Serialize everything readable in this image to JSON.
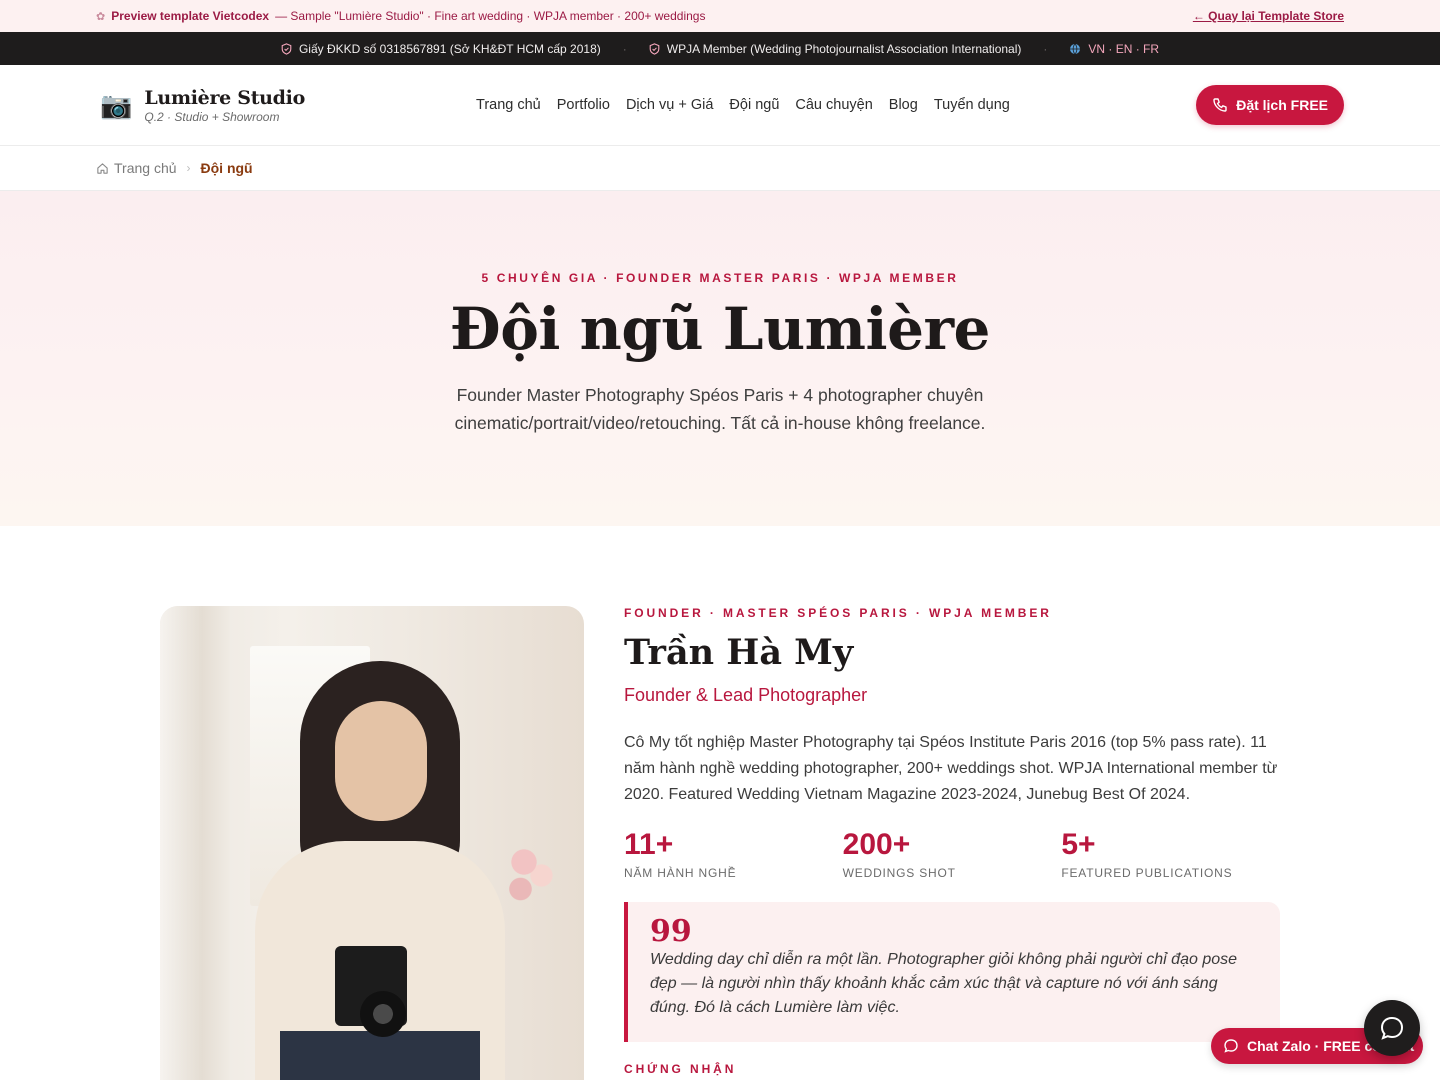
{
  "preview": {
    "brand": "Preview template Vietcodex",
    "desc": "— Sample \"Lumière Studio\" · Fine art wedding · WPJA member · 200+ weddings",
    "back_link": "← Quay lại Template Store"
  },
  "infobar": {
    "license": "Giấy ĐKKD số 0318567891 (Sở KH&ĐT HCM cấp 2018)",
    "member": "WPJA Member (Wedding Photojournalist Association International)",
    "langs": "VN · EN · FR",
    "sep": "·"
  },
  "header": {
    "logo_icon": "📷",
    "logo_title": "Lumière Studio",
    "logo_sub": "Q.2 · Studio + Showroom",
    "nav": [
      "Trang chủ",
      "Portfolio",
      "Dịch vụ + Giá",
      "Đội ngũ",
      "Câu chuyện",
      "Blog",
      "Tuyển dụng"
    ],
    "cta": "Đặt lịch FREE"
  },
  "breadcrumb": {
    "home": "Trang chủ",
    "current": "Đội ngũ"
  },
  "hero": {
    "eyebrow": "5 CHUYÊN GIA · FOUNDER MASTER PARIS · WPJA MEMBER",
    "title": "Đội ngũ Lumière",
    "subtitle": "Founder Master Photography Spéos Paris + 4 photographer chuyên cinematic/portrait/video/retouching. Tất cả in-house không freelance."
  },
  "founder": {
    "eyebrow": "FOUNDER · MASTER SPÉOS PARIS · WPJA MEMBER",
    "name": "Trần Hà My",
    "role": "Founder & Lead Photographer",
    "bio": "Cô My tốt nghiệp Master Photography tại Spéos Institute Paris 2016 (top 5% pass rate). 11 năm hành nghề wedding photographer, 200+ weddings shot. WPJA International member từ 2020. Featured Wedding Vietnam Magazine 2023-2024, Junebug Best Of 2024.",
    "stats": [
      {
        "num": "11+",
        "label": "NĂM HÀNH NGHỀ"
      },
      {
        "num": "200+",
        "label": "WEDDINGS SHOT"
      },
      {
        "num": "5+",
        "label": "FEATURED PUBLICATIONS"
      }
    ],
    "quote_mark": "99",
    "quote": "Wedding day chỉ diễn ra một lần. Photographer giỏi không phải người chỉ đạo pose đẹp — là người nhìn thấy khoảnh khắc cảm xúc thật và capture nó với ánh sáng đúng. Đó là cách Lumière làm việc.",
    "cert_label": "CHỨNG NHẬN"
  },
  "chat": {
    "label": "Chat Zalo · FREE consult"
  },
  "colors": {
    "accent": "#c8173f",
    "dark_bar": "#1e1c1c",
    "hero_bg": "#fbeef0"
  }
}
